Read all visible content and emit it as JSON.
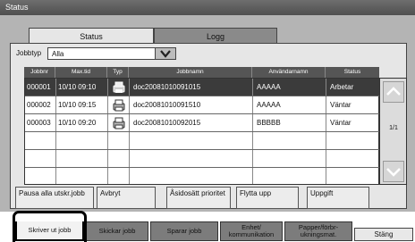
{
  "window": {
    "title": "Status"
  },
  "tabs": [
    {
      "label": "Status",
      "active": true
    },
    {
      "label": "Logg",
      "active": false
    }
  ],
  "filter": {
    "label": "Jobbtyp",
    "value": "Alla"
  },
  "table": {
    "columns": [
      "Jobbnr",
      "Max.tid",
      "Typ",
      "Jobbnamn",
      "Användarnamn",
      "Status"
    ],
    "rows": [
      {
        "jobbnr": "000001",
        "maxtid": "10/10 09:10",
        "typ_icon": "print-job-icon",
        "jobbnamn": "doc20081010091015",
        "anvandare": "AAAAA",
        "status": "Arbetar"
      },
      {
        "jobbnr": "000002",
        "maxtid": "10/10 09:15",
        "typ_icon": "print-job-icon",
        "jobbnamn": "doc20081010091510",
        "anvandare": "AAAAA",
        "status": "Väntar"
      },
      {
        "jobbnr": "000003",
        "maxtid": "10/10 09:20",
        "typ_icon": "print-job-icon",
        "jobbnamn": "doc20081010092015",
        "anvandare": "BBBBB",
        "status": "Väntar"
      }
    ],
    "page": "1/1"
  },
  "actions": {
    "pause": "Pausa alla utskr.jobb",
    "cancel": "Avbryt",
    "override": "Åsidosätt prioritet",
    "move_up": "Flytta upp",
    "details": "Uppgift"
  },
  "bottom_tabs": [
    {
      "label": "Skriver ut jobb",
      "active": true
    },
    {
      "label": "Skickar jobb",
      "active": false
    },
    {
      "label": "Sparar jobb",
      "active": false
    },
    {
      "label": "Enhet/ kommunikation",
      "active": false
    },
    {
      "label": "Papper/förbr- ukningsmat.",
      "active": false
    }
  ],
  "close": "Stäng",
  "colors": {
    "selected_row": "#3b3b3b",
    "panel": "#b4b4b4"
  }
}
